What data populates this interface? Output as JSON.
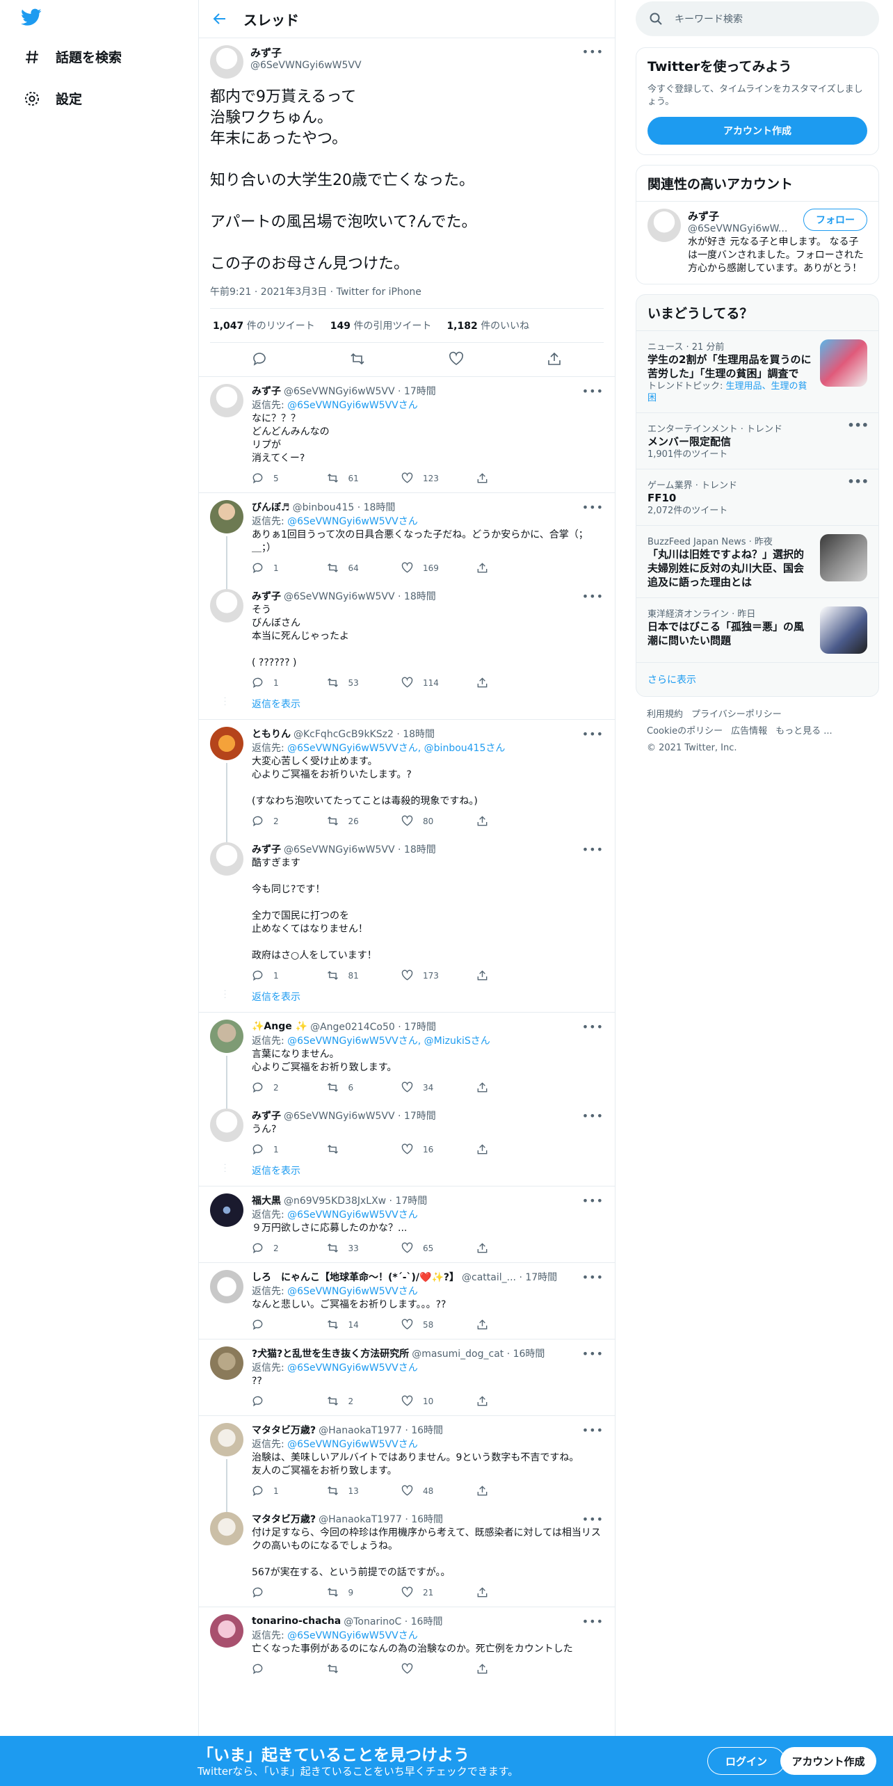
{
  "nav": {
    "explore": "話題を検索",
    "settings": "設定"
  },
  "header": {
    "title": "スレッド"
  },
  "main_tweet": {
    "name": "みず子",
    "handle": "@6SeVWNGyi6wW5VV",
    "body": "都内で9万貰えるって\n治験ワクちゅん。\n年末にあったやつ。\n\n知り合いの大学生20歳で亡くなった。\n\nアパートの風呂場で泡吹いて?んでた。\n\nこの子のお母さん見つけた。",
    "meta": "午前9:21 · 2021年3月3日 · Twitter for iPhone",
    "retweets_n": "1,047",
    "retweets_l": "件のリツイート",
    "quotes_n": "149",
    "quotes_l": "件の引用ツイート",
    "likes_n": "1,182",
    "likes_l": "件のいいね"
  },
  "replies": [
    {
      "name": "みず子",
      "handle": "@6SeVWNGyi6wW5VV · 17時間",
      "to": "返信先: ",
      "to_link": "@6SeVWNGyi6wW5VV",
      "to_suffix": "さん",
      "body": "なに？？？\nどんどんみんなの\nリプが\n消えてくー?",
      "replies": "5",
      "rts": "61",
      "likes": "123"
    },
    {
      "name": "びんぼ♬",
      "handle": "@binbou415 · 18時間",
      "to": "返信先: ",
      "to_link": "@6SeVWNGyi6wW5VV",
      "to_suffix": "さん",
      "body": "ありぁ1回目うって次の日具合悪くなった子だね。どうか安らかに、合掌（；＿；）",
      "replies": "1",
      "rts": "64",
      "likes": "169"
    },
    {
      "name": "みず子",
      "handle": "@6SeVWNGyi6wW5VV · 18時間",
      "to": "",
      "to_link": "",
      "to_suffix": "",
      "body": "そう\nびんぼさん\n本当に死んじゃったよ\n\n( ?????? )",
      "replies": "1",
      "rts": "53",
      "likes": "114"
    },
    {
      "name": "ともりん",
      "handle": "@KcFqhcGcB9kKSz2 · 18時間",
      "to": "返信先: ",
      "to_link": "@6SeVWNGyi6wW5VV",
      "to_suffix": "さん, @binbou415さん",
      "body": "大変心苦しく受け止めます。\n心よりご冥福をお祈りいたします。?\n\n(すなわち泡吹いてたってことは毒殺的現象ですね。)",
      "replies": "2",
      "rts": "26",
      "likes": "80"
    },
    {
      "name": "みず子",
      "handle": "@6SeVWNGyi6wW5VV · 18時間",
      "to": "",
      "to_link": "",
      "to_suffix": "",
      "body": "酷すぎます\n\n今も同じ?です！\n\n全力で国民に打つのを\n止めなくてはなりません！\n\n政府はさ○人をしています！",
      "replies": "1",
      "rts": "81",
      "likes": "173"
    },
    {
      "name": "✨Ange ✨",
      "handle": "@Ange0214Co50 · 17時間",
      "to": "返信先: ",
      "to_link": "@6SeVWNGyi6wW5VV",
      "to_suffix": "さん, @MizukiSさん",
      "body": "言葉になりません。\n心よりご冥福をお祈り致します。",
      "replies": "2",
      "rts": "6",
      "likes": "34"
    },
    {
      "name": "みず子",
      "handle": "@6SeVWNGyi6wW5VV · 17時間",
      "to": "",
      "to_link": "",
      "to_suffix": "",
      "body": "うん?",
      "replies": "1",
      "rts": "",
      "likes": "16"
    },
    {
      "name": "福大黒",
      "handle": "@n69V95KD38JxLXw · 17時間",
      "to": "返信先: ",
      "to_link": "@6SeVWNGyi6wW5VV",
      "to_suffix": "さん",
      "body": "９万円欲しさに応募したのかな？...",
      "replies": "2",
      "rts": "33",
      "likes": "65"
    },
    {
      "name": "しろ　にゃんこ【地球革命～！(*´-`)/❤️✨?】",
      "handle": "@cattail_... · 17時間",
      "to": "返信先: ",
      "to_link": "@6SeVWNGyi6wW5VV",
      "to_suffix": "さん",
      "body": "なんと悲しい。ご冥福をお祈りします。。。??",
      "replies": "",
      "rts": "14",
      "likes": "58"
    },
    {
      "name": "?犬猫?と乱世を生き抜く方法研究所",
      "handle": "@masumi_dog_cat · 16時間",
      "to": "返信先: ",
      "to_link": "@6SeVWNGyi6wW5VV",
      "to_suffix": "さん",
      "body": "??",
      "replies": "",
      "rts": "2",
      "likes": "10"
    },
    {
      "name": "マタタビ万歳?",
      "handle": "@HanaokaT1977 · 16時間",
      "to": "返信先: ",
      "to_link": "@6SeVWNGyi6wW5VV",
      "to_suffix": "さん",
      "body": "治験は、美味しいアルバイトではありません。9という数字も不吉ですね。\n友人のご冥福をお祈り致します。",
      "replies": "1",
      "rts": "13",
      "likes": "48"
    },
    {
      "name": "マタタビ万歳?",
      "handle": "@HanaokaT1977 · 16時間",
      "to": "",
      "to_link": "",
      "to_suffix": "",
      "body": "付け足すなら、今回の枠珍は作用機序から考えて、既感染者に対しては相当リスクの高いものになるでしょうね。\n\n567が実在する、という前提での話ですが。。",
      "replies": "",
      "rts": "9",
      "likes": "21"
    },
    {
      "name": "tonarino-chacha",
      "handle": "@TonarinoC · 16時間",
      "to": "返信先: ",
      "to_link": "@6SeVWNGyi6wW5VV",
      "to_suffix": "さん",
      "body": "亡くなった事例があるのになんの為の治験なのか。死亡例をカウントした",
      "replies": "",
      "rts": "",
      "likes": ""
    }
  ],
  "show_replies": "返信を表示",
  "sidebar": {
    "search_placeholder": "キーワード検索",
    "signup_title": "Twitterを使ってみよう",
    "signup_text": "今すぐ登録して、タイムラインをカスタマイズしましょう。",
    "signup_button": "アカウント作成",
    "related_title": "関連性の高いアカウント",
    "related_name": "みず子",
    "related_handle": "@6SeVWNGyi6wW...",
    "related_follow": "フォロー",
    "related_bio": "水が好き 元なる子と申します。 なる子は一度バンされました。フォローされた方心から感謝しています。ありがとう！",
    "trends_title": "いまどうしてる？",
    "trends": [
      {
        "meta": "ニュース · 21 分前",
        "title": "学生の2割が「生理用品を買うのに苦労した」「生理の貧困」調査で",
        "sub": "トレンドトピック: ",
        "sub_link": "生理用品、生理の貧困"
      },
      {
        "meta": "エンターテインメント · トレンド",
        "title": "メンバー限定配信",
        "sub": "1,901件のツイート",
        "sub_link": ""
      },
      {
        "meta": "ゲーム業界 · トレンド",
        "title": "FF10",
        "sub": "2,072件のツイート",
        "sub_link": ""
      },
      {
        "meta": "BuzzFeed Japan News · 昨夜",
        "title": "「丸川は旧姓ですよね？」選択的夫婦別姓に反対の丸川大臣、国会追及に語った理由とは",
        "sub": "",
        "sub_link": ""
      },
      {
        "meta": "東洋経済オンライン · 昨日",
        "title": "日本ではびこる「孤独＝悪」の風潮に問いたい問題",
        "sub": "",
        "sub_link": ""
      }
    ],
    "show_more": "さらに表示",
    "footer": [
      "利用規約",
      "プライバシーポリシー",
      "Cookieのポリシー",
      "広告情報",
      "もっと見る ...",
      "© 2021 Twitter, Inc."
    ]
  },
  "bottom_bar": {
    "title": "「いま」起きていることを見つけよう",
    "subtitle": "Twitterなら、「いま」起きていることをいち早くチェックできます。",
    "login": "ログイン",
    "signup": "アカウント作成"
  },
  "colors": {
    "accent": "#1d9bf0"
  }
}
